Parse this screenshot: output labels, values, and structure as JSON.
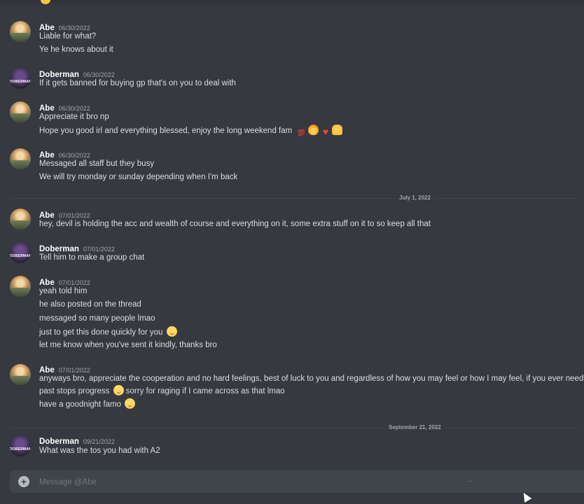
{
  "messages": [
    {
      "user": "Abe",
      "timestamp": "06/30/2022",
      "lines": [
        "Liable for what?",
        "Ye he knows about it"
      ]
    },
    {
      "user": "Doberman",
      "timestamp": "06/30/2022",
      "avatar_text": "DOBERMAN",
      "lines": [
        "If it gets banned for buying gp that's on you to deal with"
      ]
    },
    {
      "user": "Abe",
      "timestamp": "06/30/2022",
      "lines": [
        "Appreciate it bro np",
        "Hope you good irl and everything blessed, enjoy the long weekend fam"
      ]
    },
    {
      "user": "Abe",
      "timestamp": "06/30/2022",
      "lines": [
        "Messaged all staff but they busy",
        "We will try monday or sunday depending when I'm back"
      ]
    },
    {
      "user": "Abe",
      "timestamp": "07/01/2022",
      "lines": [
        "hey, devil is holding the acc and wealth of course and everything on it, some extra stuff on it to so keep all that"
      ]
    },
    {
      "user": "Doberman",
      "timestamp": "07/01/2022",
      "avatar_text": "DOBERMAN",
      "lines": [
        "Tell him to make a group chat"
      ]
    },
    {
      "user": "Abe",
      "timestamp": "07/01/2022",
      "lines": [
        "yeah told him",
        "he also posted on the thread",
        "messaged so many people lmao",
        "just to get this done quickly for you",
        "let me know when you've sent it kindly, thanks bro"
      ]
    },
    {
      "user": "Abe",
      "timestamp": "07/01/2022",
      "lines": [
        "anyways bro, appreciate the cooperation and no hard feelings, best of luck to you and regardless of how you may feel or how I may feel, if you ever needf anythi",
        "past stops progress",
        "sorry for raging if I came across as that lmao",
        "have a goodnight famo"
      ]
    },
    {
      "user": "Doberman",
      "timestamp": "09/21/2022",
      "avatar_text": "DOBERMAN",
      "lines": [
        "What was the tos you had with A2"
      ]
    }
  ],
  "dividers": [
    "July 1, 2022",
    "September 21, 2022"
  ],
  "composer": {
    "placeholder": "Message @Abe",
    "add_label": "+"
  },
  "icons": {
    "emoji_hope_line": [
      "hundred-icon",
      "fire-icon",
      "heart-icon",
      "pray-icon"
    ],
    "emoji_smile": "slightly-smiling-face-icon"
  },
  "colors": {
    "background": "#36393f",
    "composer": "#40444b",
    "username": "#ffffff",
    "text": "#dcddde",
    "muted": "#a3a6aa"
  }
}
